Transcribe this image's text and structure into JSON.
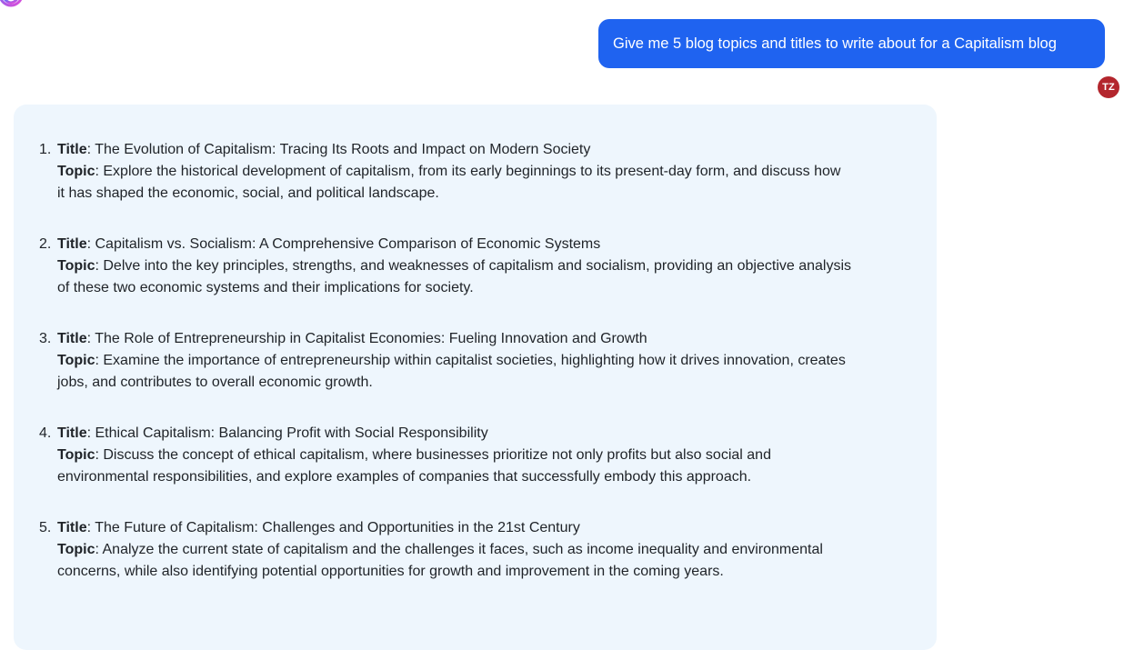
{
  "user": {
    "message": "Give me 5 blog topics and titles to write about for a Capitalism blog",
    "avatar_initials": "TZ"
  },
  "assistant": {
    "title_label": "Title",
    "topic_label": "Topic",
    "items": [
      {
        "number": "1.",
        "title": "The Evolution of Capitalism: Tracing Its Roots and Impact on Modern Society",
        "topic_line1": "Explore the historical development of capitalism, from its early beginnings to its present-day form, and discuss how",
        "topic_line2": "it has shaped the economic, social, and political landscape."
      },
      {
        "number": "2.",
        "title": "Capitalism vs. Socialism: A Comprehensive Comparison of Economic Systems",
        "topic_line1": "Delve into the key principles, strengths, and weaknesses of capitalism and socialism, providing an objective analysis",
        "topic_line2": "of these two economic systems and their implications for society."
      },
      {
        "number": "3.",
        "title": "The Role of Entrepreneurship in Capitalist Economies: Fueling Innovation and Growth",
        "topic_line1": "Examine the importance of entrepreneurship within capitalist societies, highlighting how it drives innovation, creates",
        "topic_line2": "jobs, and contributes to overall economic growth."
      },
      {
        "number": "4.",
        "title": "Ethical Capitalism: Balancing Profit with Social Responsibility",
        "topic_line1": "Discuss the concept of ethical capitalism, where businesses prioritize not only profits but also social and",
        "topic_line2": "environmental responsibilities, and explore examples of companies that successfully embody this approach."
      },
      {
        "number": "5.",
        "title": "The Future of Capitalism: Challenges and Opportunities in the 21st Century",
        "topic_line1": "Analyze the current state of capitalism and the challenges it faces, such as income inequality and environmental",
        "topic_line2": "concerns, while also identifying potential opportunities for growth and improvement in the coming years."
      }
    ]
  },
  "colors": {
    "user_bubble": "#1f63f0",
    "avatar": "#b3262d",
    "assistant_panel": "#eef6fd"
  },
  "icons": {
    "bot_logo": "assistant-logo-icon"
  }
}
